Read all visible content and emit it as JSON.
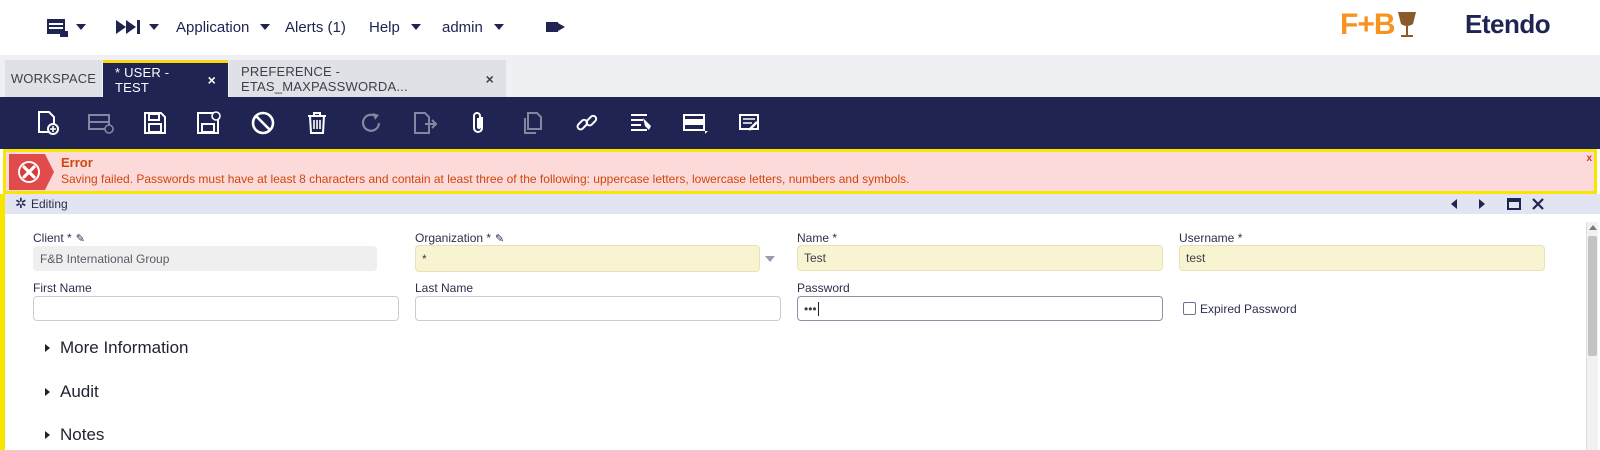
{
  "topbar": {
    "menus": [
      {
        "label": "Application",
        "has_dropdown": true
      },
      {
        "label": "Alerts (1)",
        "has_dropdown": false
      },
      {
        "label": "Help",
        "has_dropdown": true
      },
      {
        "label": "admin",
        "has_dropdown": true
      }
    ],
    "icons": [
      "new-window-icon",
      "quick-launch-icon",
      "logout-icon"
    ],
    "logo_client": "F+B",
    "logo_brand": "Etendo"
  },
  "tabs": [
    {
      "label": "WORKSPACE",
      "active": false,
      "closable": false
    },
    {
      "label": "* USER - TEST",
      "active": true,
      "closable": true
    },
    {
      "label": "PREFERENCE - ETAS_MAXPASSWORDA...",
      "active": false,
      "closable": true
    }
  ],
  "toolbar": {
    "buttons": [
      "new-document-icon",
      "new-row-icon",
      "save-icon",
      "save-close-icon",
      "cancel-icon",
      "delete-icon",
      "refresh-icon",
      "export-icon",
      "attachment-icon",
      "clone-icon",
      "link-icon",
      "filter-icon",
      "grid-view-icon",
      "notes-icon"
    ]
  },
  "message": {
    "title": "Error",
    "text": "Saving failed. Passwords must have at least 8 characters and contain at least three of the following: uppercase letters, lowercase letters, numbers and symbols.",
    "close": "x",
    "colors": {
      "background": "#fcdada",
      "border": "#f8e600",
      "text": "#d0460c"
    }
  },
  "form": {
    "status": "Editing",
    "fields": {
      "client": {
        "label": "Client *",
        "value": "F&B International Group"
      },
      "organization": {
        "label": "Organization *",
        "value": "*"
      },
      "name": {
        "label": "Name *",
        "value": "Test"
      },
      "username": {
        "label": "Username *",
        "value": "test"
      },
      "first_name": {
        "label": "First Name",
        "value": ""
      },
      "last_name": {
        "label": "Last Name",
        "value": ""
      },
      "password": {
        "label": "Password",
        "value": "•••"
      },
      "expired_password": {
        "label": "Expired Password",
        "checked": false
      }
    },
    "sections": [
      "More Information",
      "Audit",
      "Notes"
    ]
  },
  "colors": {
    "primary": "#202452",
    "accent": "#fad614",
    "brand_orange": "#f7931e"
  }
}
